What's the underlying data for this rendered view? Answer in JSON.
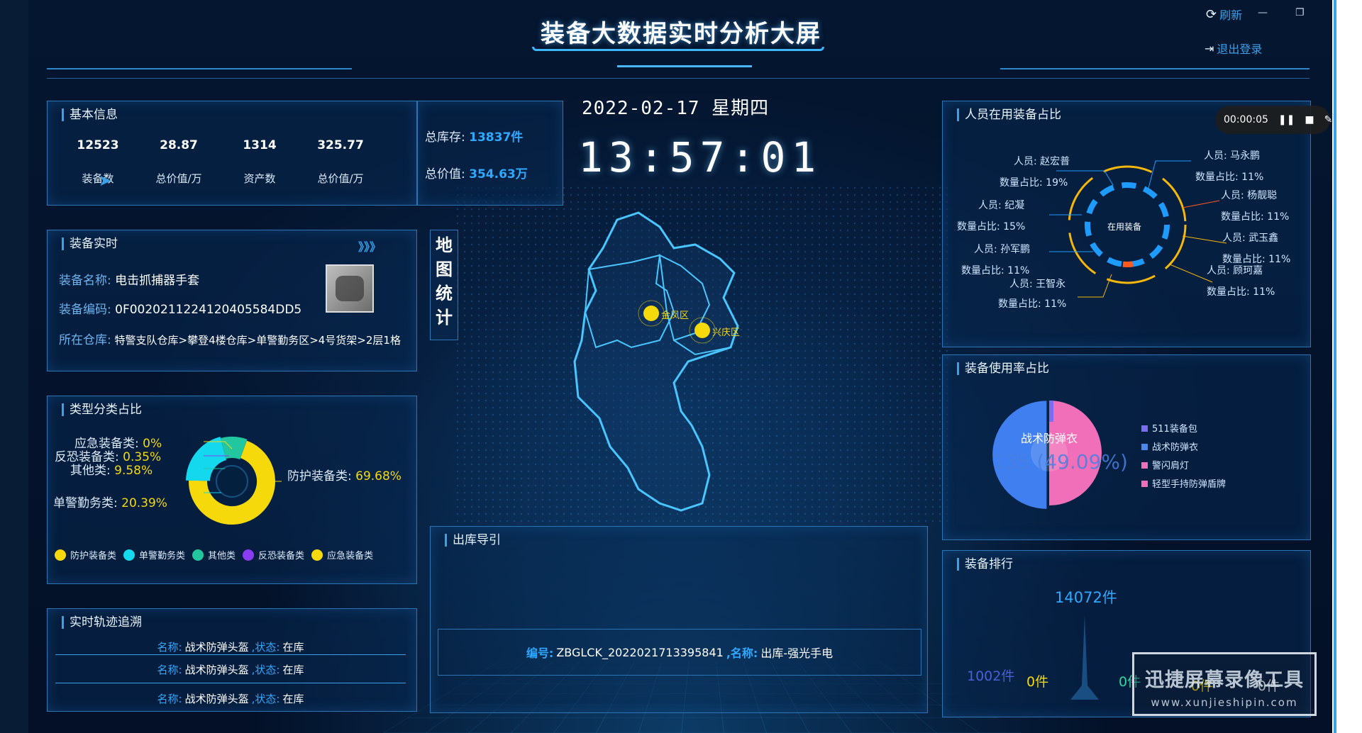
{
  "header": {
    "title": "装备大数据实时分析大屏",
    "refresh_label": "刷新",
    "logout_label": "退出登录",
    "window_minimize": "—",
    "window_restore": "❐"
  },
  "basic_info": {
    "title": "基本信息",
    "stats": [
      {
        "value": "12523",
        "label": "装备数"
      },
      {
        "value": "28.87",
        "label": "总价值/万"
      },
      {
        "value": "1314",
        "label": "资产数"
      },
      {
        "value": "325.77",
        "label": "总价值/万"
      }
    ],
    "inventory_label": "总库存:",
    "inventory_value": "13837件",
    "total_value_label": "总价值:",
    "total_value_value": "354.63万"
  },
  "datetime": {
    "date": "2022-02-17 星期四",
    "time": "13:57:01"
  },
  "equipment_realtime": {
    "title": "装备实时",
    "arrows": "》》》",
    "name_label": "装备名称:",
    "name_value": "电击抓捕器手套",
    "code_label": "装备编码:",
    "code_value": "0F0020211224120405584DD5",
    "warehouse_label": "所在仓库:",
    "warehouse_value": "特警支队仓库>攀登4楼仓库>单警勤务区>4号货架>2层1格"
  },
  "type_ratio": {
    "title": "类型分类占比",
    "labels": [
      {
        "name": "应急装备类:",
        "value": "0%"
      },
      {
        "name": "反恐装备类:",
        "value": "0.35%"
      },
      {
        "name": "其他类:",
        "value": "9.58%"
      },
      {
        "name": "单警勤务类:",
        "value": "20.39%"
      },
      {
        "name": "防护装备类:",
        "value": "69.68%"
      }
    ],
    "legend": [
      {
        "name": "防护装备类",
        "color": "#f5d90a"
      },
      {
        "name": "单警勤务类",
        "color": "#14d8ee"
      },
      {
        "name": "其他类",
        "color": "#22c7a0"
      },
      {
        "name": "反恐装备类",
        "color": "#8a3df0"
      },
      {
        "name": "应急装备类",
        "color": "#f5d90a"
      }
    ]
  },
  "track": {
    "title": "实时轨迹追溯",
    "rows": [
      {
        "name_label": "名称:",
        "name": "战术防弹头盔",
        "status_label": ",状态:",
        "status": "在库"
      },
      {
        "name_label": "名称:",
        "name": "战术防弹头盔",
        "status_label": ",状态:",
        "status": "在库"
      },
      {
        "name_label": "名称:",
        "name": "战术防弹头盔",
        "status_label": ",状态:",
        "status": "在库"
      }
    ]
  },
  "map": {
    "vertical_title": [
      "地",
      "图",
      "统",
      "计"
    ],
    "markers": [
      "金凤区",
      "兴庆区"
    ]
  },
  "outbound": {
    "title": "出库导引",
    "code_label": "编号:",
    "code_value": "ZBGLCK_2022021713395841",
    "name_label": ",名称:",
    "name_value": "出库-强光手电"
  },
  "personnel_ratio": {
    "title": "人员在用装备占比",
    "center_label": "在用装备",
    "entries": [
      {
        "person": "人员: 赵宏普",
        "ratio": "数量占比: 19%"
      },
      {
        "person": "人员: 纪凝",
        "ratio": "数量占比: 15%"
      },
      {
        "person": "人员: 孙军鹏",
        "ratio": "数量占比: 11%"
      },
      {
        "person": "人员: 王智永",
        "ratio": "数量占比: 11%"
      },
      {
        "person": "人员: 马永鹏",
        "ratio": "数量占比: 11%"
      },
      {
        "person": "人员: 杨靓聪",
        "ratio": "数量占比: 11%"
      },
      {
        "person": "人员: 武玉鑫",
        "ratio": "数量占比: 11%"
      },
      {
        "person": "人员: 顾珂嘉",
        "ratio": "数量占比: 11%"
      }
    ]
  },
  "usage_ratio": {
    "title": "装备使用率占比",
    "center_name": "战术防弹衣",
    "center_value": "135 (49.09%)",
    "legend": [
      {
        "name": "511装备包",
        "color": "#7b6cf0"
      },
      {
        "name": "战术防弹衣",
        "color": "#4a86f0"
      },
      {
        "name": "警闪肩灯",
        "color": "#f06fb8"
      },
      {
        "name": "轻型手持防弹盾牌",
        "color": "#f06fb8"
      }
    ]
  },
  "ranking": {
    "title": "装备排行",
    "top_value": "14072件",
    "values": [
      "1002件",
      "0件",
      "0件",
      "0件",
      "0件"
    ]
  },
  "recorder": {
    "time": "00:00:05"
  },
  "watermark": {
    "line1": "迅捷屏幕录像工具",
    "line2": "www.xunjieshipin.com"
  }
}
